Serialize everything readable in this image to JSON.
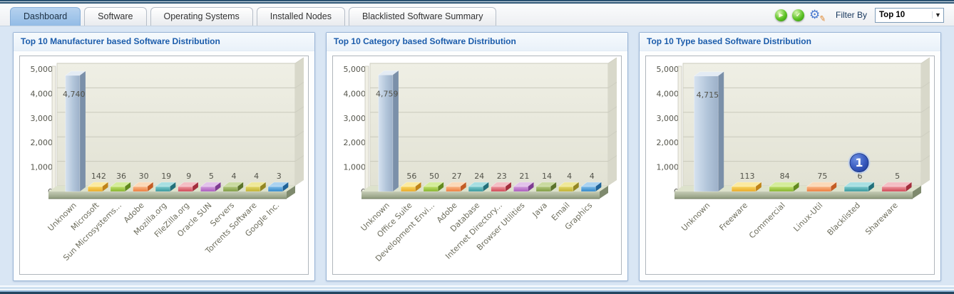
{
  "tabs": [
    {
      "label": "Dashboard",
      "active": true
    },
    {
      "label": "Software",
      "active": false
    },
    {
      "label": "Operating Systems",
      "active": false
    },
    {
      "label": "Installed Nodes",
      "active": false
    },
    {
      "label": "Blacklisted Software Summary",
      "active": false
    }
  ],
  "toolbar": {
    "filter_label": "Filter By",
    "filter_value": "Top 10",
    "icons": [
      "run-icon",
      "approve-icon",
      "settings-icon"
    ]
  },
  "colors": {
    "title_blue": "#1b5cab",
    "active_tab": "#9fc3e7",
    "plot_wall": "#e9e9dd",
    "big_bar": "#b2c5da",
    "badge_blue": "#2a4fae"
  },
  "bar_palette": [
    {
      "light": "#f7d763",
      "dark": "#e9a825",
      "side": "#c08418",
      "top": "#fbeaa0"
    },
    {
      "light": "#c0e06c",
      "dark": "#84b32a",
      "side": "#628a1e",
      "top": "#d4ec9a"
    },
    {
      "light": "#f8b98a",
      "dark": "#ee7b3a",
      "side": "#c45c24",
      "top": "#fbd9b8"
    },
    {
      "light": "#7ecbce",
      "dark": "#35969b",
      "side": "#22707a",
      "top": "#a8dfe2"
    },
    {
      "light": "#ee9aa2",
      "dark": "#cf4553",
      "side": "#a32e3c",
      "top": "#f4bec4"
    },
    {
      "light": "#d2a0dd",
      "dark": "#a958bd",
      "side": "#7e3c92",
      "top": "#e2c2ea"
    },
    {
      "light": "#b3c97f",
      "dark": "#7d9a40",
      "side": "#5c742c",
      "top": "#c9daa0"
    },
    {
      "light": "#e3d96a",
      "dark": "#c0b02f",
      "side": "#948722",
      "top": "#efe898"
    },
    {
      "light": "#7fbce8",
      "dark": "#2f86c8",
      "side": "#1f6298",
      "top": "#aad2f0"
    }
  ],
  "chart_data": [
    {
      "type": "bar",
      "title": "Top 10 Manufacturer based Software Distribution",
      "categories": [
        "Unknown",
        "Microsoft",
        "Sun Microsystems...",
        "Adobe",
        "Mozilla.org",
        "FileZilla.org",
        "Oracle SUN",
        "Servers",
        "Torrents Software",
        "Google Inc."
      ],
      "values": [
        4740,
        142,
        36,
        30,
        19,
        9,
        5,
        4,
        4,
        3
      ],
      "ylim": [
        0,
        5000
      ],
      "ytick_step": 1000,
      "grid": true,
      "legend": "none",
      "style": "3d-bar"
    },
    {
      "type": "bar",
      "title": "Top 10 Category based Software Distribution",
      "categories": [
        "Unknown",
        "Office Suite",
        "Development Envi...",
        "Adobe",
        "Database",
        "Internet Directory...",
        "Browser Utilities",
        "Java",
        "Email",
        "Graphics"
      ],
      "values": [
        4759,
        56,
        50,
        27,
        24,
        23,
        21,
        14,
        4,
        4
      ],
      "ylim": [
        0,
        5000
      ],
      "ytick_step": 1000,
      "grid": true,
      "legend": "none",
      "style": "3d-bar"
    },
    {
      "type": "bar",
      "title": "Top 10 Type based Software Distribution",
      "categories": [
        "Unknown",
        "Freeware",
        "Commercial",
        "Linux-Util",
        "Blacklisted",
        "Shareware"
      ],
      "values": [
        4715,
        113,
        84,
        75,
        6,
        5
      ],
      "ylim": [
        0,
        5000
      ],
      "ytick_step": 1000,
      "grid": true,
      "legend": "none",
      "style": "3d-bar",
      "annotation": {
        "label": "1",
        "category": "Blacklisted",
        "at_value": 1000
      }
    }
  ]
}
